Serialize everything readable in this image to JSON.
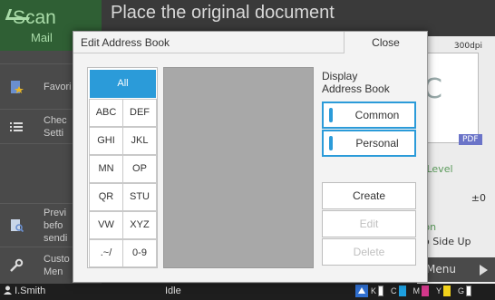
{
  "background": {
    "app": {
      "line1": "Scan",
      "line2": "Mail"
    },
    "title": "Place the original document",
    "nav": [
      {
        "label1": "Favori",
        "label2": ""
      },
      {
        "label1": "Chec",
        "label2": "Setti"
      },
      {
        "label1": "",
        "label2": ""
      },
      {
        "label1": "Previ",
        "label2": "befo",
        "label3": "sendi"
      },
      {
        "label1": "Custo",
        "label2": "Men"
      }
    ],
    "right_panel": {
      "dpi": "300dpi",
      "preview_letter": "C",
      "file_badge": "PDF",
      "level_label": "g Level",
      "level_value": "±0",
      "option_label": "tion",
      "option_value": "op Side Up"
    },
    "menu_label": "Menu",
    "status": {
      "user": "I.Smith",
      "state": "Idle",
      "inks": [
        {
          "letter": "K",
          "color": "#222222"
        },
        {
          "letter": "C",
          "color": "#1ea0e0"
        },
        {
          "letter": "M",
          "color": "#d4388c"
        },
        {
          "letter": "Y",
          "color": "#f2d21b"
        },
        {
          "letter": "G",
          "color": "#888888"
        }
      ]
    }
  },
  "dialog": {
    "title": "Edit Address Book",
    "close_label": "Close",
    "index_all": "All",
    "index_keys": [
      "ABC",
      "DEF",
      "GHI",
      "JKL",
      "MN",
      "OP",
      "QR",
      "STU",
      "VW",
      "XYZ",
      ".~/",
      "0-9"
    ],
    "display_label_line1": "Display",
    "display_label_line2": "Address Book",
    "toggle_common": "Common",
    "toggle_personal": "Personal",
    "create_label": "Create",
    "edit_label": "Edit",
    "delete_label": "Delete",
    "accent_color": "#2b9bd9"
  }
}
